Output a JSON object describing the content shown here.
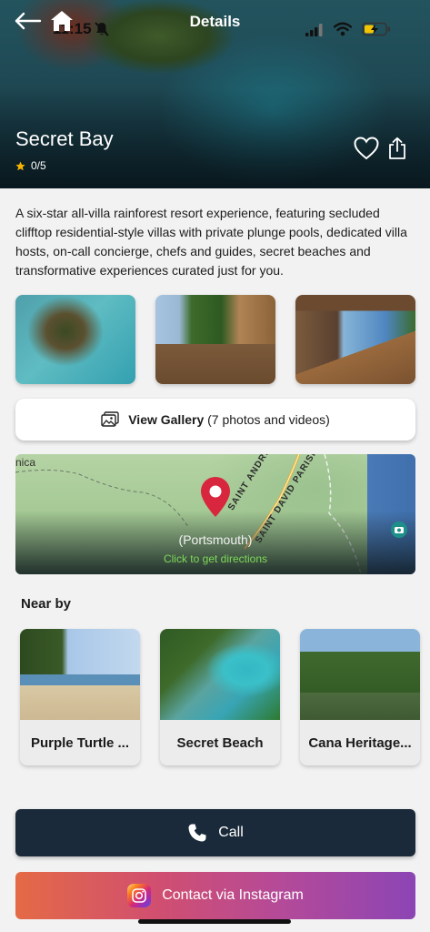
{
  "status_bar": {
    "time": "11:15"
  },
  "header": {
    "title": "Details"
  },
  "place": {
    "name": "Secret Bay",
    "rating": "0/5",
    "description": "A six-star all-villa rainforest resort experience, featuring secluded clifftop residential-style villas with private plunge pools, dedicated villa hosts, on-call concierge, chefs and guides, secret beaches and transformative experiences curated just for you."
  },
  "gallery": {
    "bold_label": "View Gallery",
    "count_label": "(7 photos and videos)"
  },
  "map": {
    "corner_label": "nica",
    "parish_label_1": "SAINT ANDREW PARISH",
    "parish_label_2": "SAINT DAVID PARISH",
    "location": "(Portsmouth)",
    "directions": "Click to get directions"
  },
  "nearby": {
    "title": "Near by",
    "items": [
      {
        "name": "Purple Turtle ..."
      },
      {
        "name": "Secret Beach"
      },
      {
        "name": "Cana Heritage..."
      }
    ]
  },
  "actions": {
    "call": "Call",
    "instagram": "Contact via Instagram"
  },
  "colors": {
    "primary_dark": "#1a2a3a",
    "directions_green": "#7ed957",
    "pin_red": "#d7263d",
    "star": "#f5b400"
  }
}
